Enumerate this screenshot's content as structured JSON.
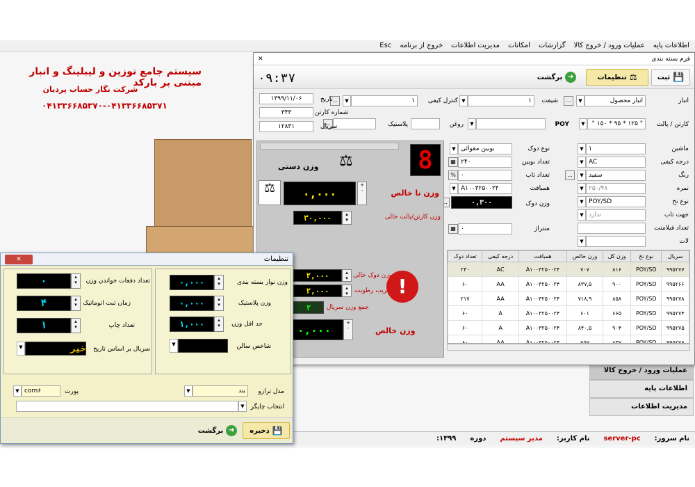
{
  "menu": [
    "اطلاعات پایه",
    "عملیات ورود / خروج کالا",
    "گزارشات",
    "امکانات",
    "مدیریت اطلاعات",
    "خروج از برنامه",
    "Esc"
  ],
  "brand": {
    "title": "سیستم جامع توزین و لیبلینگ و انبار مبتنی بر بارکد",
    "company": "شرکت نگار حساب پردیان",
    "phone": "۰۴۱۳۳۶۶۸۵۳۷۰-۰۴۱۳۳۶۶۸۵۳۷۱"
  },
  "right_nav": [
    "عملیات ورود / خروج کالا",
    "اطلاعات پایه",
    "مدیریت اطلاعات"
  ],
  "status": {
    "server_label": "نام سرور:",
    "server": "server-pc",
    "user_label": "نام کاربر:",
    "user": "مدیر سیستم",
    "period_label": "دوره",
    "period": "۱۳۹۹:"
  },
  "main": {
    "title": "فرم بسته بندی",
    "clock": "۰۹:۳۷",
    "toolbar": {
      "save": "ثبت",
      "settings": "تنظیمات",
      "back": "برگشت"
    },
    "header": {
      "warehouse_label": "انبار",
      "warehouse": "انبار محصول",
      "shift_label": "شیفت",
      "shift": "۱",
      "qc_label": "کنترل کیفی",
      "qc": "۱",
      "date_label": "تاریخ",
      "date": "۱۳۹۹/۱۱/۰۶",
      "carton_no_label": "شماره کارتن",
      "carton_no": "۳۴۳",
      "serial_label": "سریال",
      "serial": "۱۲۸۳۱",
      "carton_label": "کارتن / پالت",
      "carton": "\" ۱۲۵ * ۹۵ * ۱۵۰ \"",
      "poy": "POY",
      "oil_label": "روغن",
      "plastic_label": "پلاستیک"
    },
    "form": {
      "machine_label": "ماشین",
      "machine": "۱",
      "grade_label": "درجه کیفی",
      "grade": "AC",
      "color_label": "رنگ",
      "color": "سفید",
      "nomre_label": "نمره",
      "nomre": "۲۵۰/۴۸",
      "thread_label": "نوع نخ",
      "thread": "POY/SD",
      "twist_label": "جهت تاب",
      "twist": "ندارد",
      "filament_label": "تعداد فیلامنت",
      "lot_label": "لات",
      "spool_type_label": "نوع دوک",
      "spool_type": "بوبین مقوائی",
      "bobbin_count_label": "تعداد بوبین",
      "bobbin_count": "۲۴۰",
      "twist_count_label": "تعداد تاب",
      "twist_count": "۰",
      "merge_label": "همبافت",
      "merge": "A۱۰۰۳۲۵۰۰۲۴",
      "spool_weight_label": "وزن دوک",
      "spool_weight": "۰,۳۰۰",
      "shrink_label": "منتراژ",
      "shrink": "۰"
    },
    "weigh": {
      "manual": "وزن دستی",
      "gross_label": "وزن نا خالص",
      "gross": "۰,۰۰۰",
      "carton_weight_label": "وزن کارتن/پالت خالی",
      "carton_weight": "۳۰,۰۰۰",
      "empty_spool_label": "وزن دوک خالی",
      "empty_spool": "۲,۰۰۰",
      "moisture_label": "ضریب رطوبت",
      "moisture": "۲,۰۰۰",
      "serial_sum_label": "جمع وزن سریال",
      "serial_sum": "۲",
      "net_label": "وزن خالص",
      "net": "۰,۰۰۰",
      "digit": "8"
    },
    "table": {
      "headers": [
        "سریال",
        "نوع نخ",
        "وزن کل",
        "وزن خالص",
        "همبافت",
        "درجه کیفی",
        "تعداد دوک"
      ],
      "rows": [
        [
          "۹۹۵۲۷۷",
          "POY/SD",
          "۸۱۶",
          "۷۰۷",
          "A۱۰۰۳۲۵۰۰۲۴",
          "AC",
          "۲۴۰"
        ],
        [
          "۹۹۵۲۶۶",
          "POY/SD",
          "۹۰۰",
          "۸۳۷,۵",
          "A۱۰۰۳۲۵۰۰۲۴",
          "AA",
          "۶۰"
        ],
        [
          "۹۹۵۲۷۸",
          "POY/SD",
          "۸۵۸",
          "۷۱۸,۹",
          "A۱۰۰۳۲۵۰۰۲۴",
          "AA",
          "۲۱۷"
        ],
        [
          "۹۹۵۲۷۴",
          "POY/SD",
          "۶۶۵",
          "۶۰۱",
          "A۱۰۰۳۲۵۰۰۲۴",
          "A",
          "۶۰"
        ],
        [
          "۹۹۵۲۷۵",
          "POY/SD",
          "۹۰۴",
          "۸۴۰,۵",
          "A۱۰۰۳۲۵۰۰۲۴",
          "A",
          "۶۰"
        ],
        [
          "۹۹۵۲۷۶",
          "POY/SD",
          "۸۳۷",
          "۷۵۷",
          "A۱۰۰۳۲۵۰۰۲۴",
          "AA",
          "۶۰"
        ]
      ]
    }
  },
  "settings": {
    "title": "تنظیمات",
    "left": {
      "read_count_label": "تعداد دفعات خواندن وزن",
      "read_count": "۰",
      "auto_time_label": "زمان ثبت اتوماتیک",
      "auto_time": "۴",
      "print_count_label": "تعداد چاپ",
      "print_count": "۱",
      "serial_by_date_label": "سریال بر اساس تاریخ",
      "serial_by_date": "خیر"
    },
    "right": {
      "tape_weight_label": "وزن نوار بسته بندی",
      "tape_weight": "۰,۰۰۰",
      "plastic_weight_label": "وزن پلاستیک",
      "plastic_weight": "۰,۰۰۰",
      "min_weight_label": "حد اقل وزن",
      "min_weight": "۱,۰۰۰",
      "year_index_label": "شاخص سالن"
    },
    "scale_model_label": "مدل ترازو",
    "scale_model": "بند",
    "port_label": "پورت",
    "port": "com۶",
    "printer_label": "انتخاب چاپگر",
    "save": "ذخیره",
    "back": "برگشت"
  }
}
